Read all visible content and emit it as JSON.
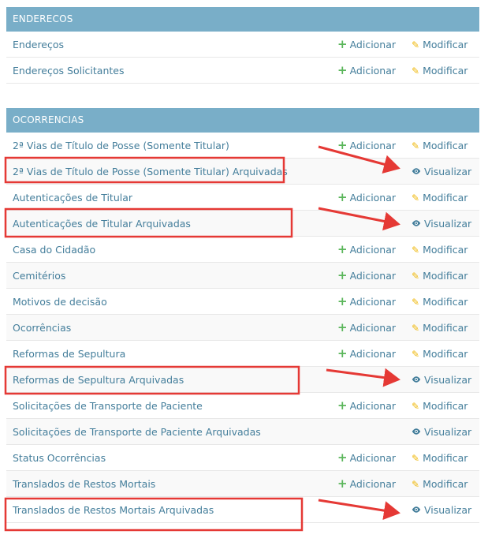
{
  "enderecos": {
    "caption": "ENDERECOS",
    "rows": [
      {
        "name": "Endereços",
        "add": "Adicionar",
        "change": "Modificar"
      },
      {
        "name": "Endereços Solicitantes",
        "add": "Adicionar",
        "change": "Modificar"
      }
    ]
  },
  "ocorrencias": {
    "caption": "OCORRENCIAS",
    "rows": [
      {
        "name": "2ª Vias de Título de Posse (Somente Titular)",
        "add": "Adicionar",
        "change": "Modificar"
      },
      {
        "name": "2ª Vias de Título de Posse (Somente Titular) Arquivadas",
        "view": "Visualizar"
      },
      {
        "name": "Autenticações de Titular",
        "add": "Adicionar",
        "change": "Modificar"
      },
      {
        "name": "Autenticações de Titular Arquivadas",
        "view": "Visualizar"
      },
      {
        "name": "Casa do Cidadão",
        "add": "Adicionar",
        "change": "Modificar"
      },
      {
        "name": "Cemitérios",
        "add": "Adicionar",
        "change": "Modificar"
      },
      {
        "name": "Motivos de decisão",
        "add": "Adicionar",
        "change": "Modificar"
      },
      {
        "name": "Ocorrências",
        "add": "Adicionar",
        "change": "Modificar"
      },
      {
        "name": "Reformas de Sepultura",
        "add": "Adicionar",
        "change": "Modificar"
      },
      {
        "name": "Reformas de Sepultura Arquivadas",
        "view": "Visualizar"
      },
      {
        "name": "Solicitações de Transporte de Paciente",
        "add": "Adicionar",
        "change": "Modificar"
      },
      {
        "name": "Solicitações de Transporte de Paciente Arquivadas",
        "view": "Visualizar"
      },
      {
        "name": "Status Ocorrências",
        "add": "Adicionar",
        "change": "Modificar"
      },
      {
        "name": "Translados de Restos Mortais",
        "add": "Adicionar",
        "change": "Modificar"
      },
      {
        "name": "Translados de Restos Mortais Arquivadas",
        "view": "Visualizar"
      }
    ]
  },
  "icons": {
    "add": "plus-icon",
    "change": "pencil-icon",
    "view": "eye-icon"
  },
  "colors": {
    "caption_bg": "#79aec8",
    "link": "#447e9b",
    "plus": "#5bb65b",
    "pencil": "#efb80b",
    "annotation": "#e53935"
  }
}
